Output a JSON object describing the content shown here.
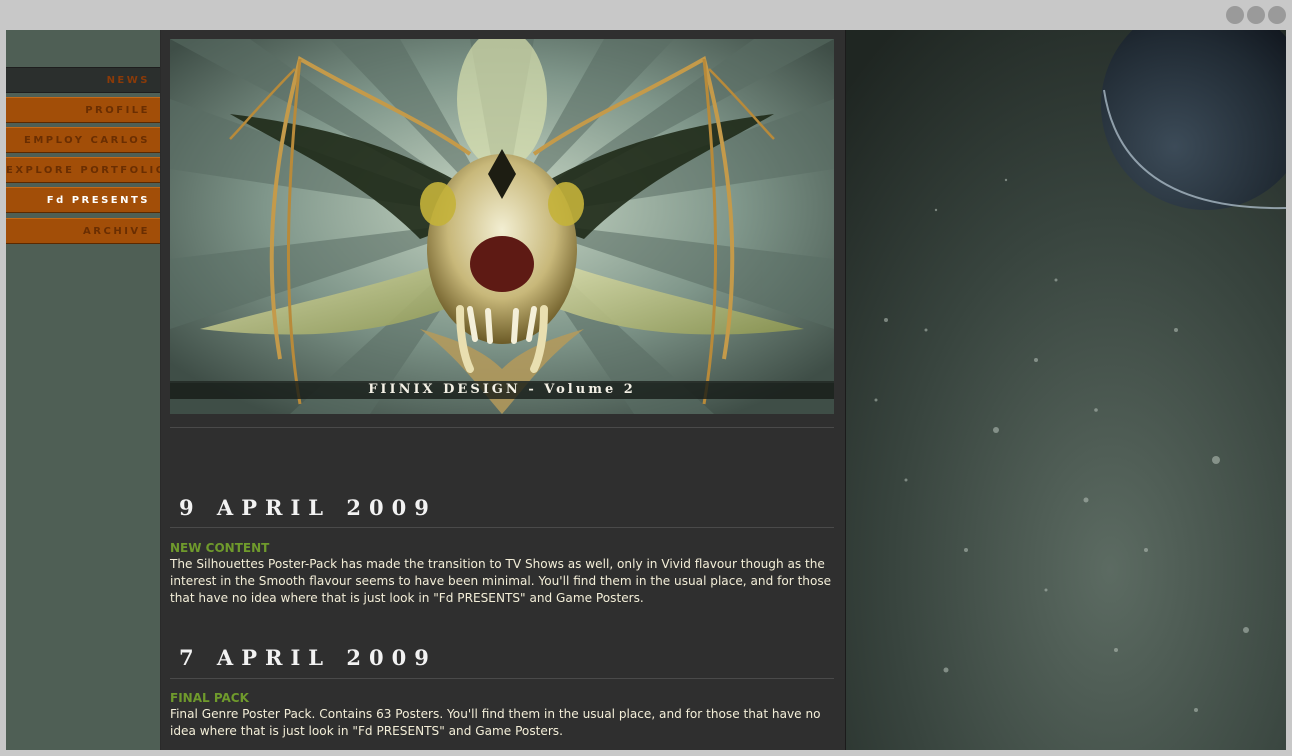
{
  "nav": {
    "items": [
      {
        "label": "NEWS",
        "state": "active"
      },
      {
        "label": "PROFILE",
        "state": "normal"
      },
      {
        "label": "EMPLOY CARLOS",
        "state": "normal"
      },
      {
        "label": "EXPLORE PORTFOLIO",
        "state": "normal"
      },
      {
        "label": "Fd PRESENTS",
        "state": "current"
      },
      {
        "label": "ARCHIVE",
        "state": "normal"
      }
    ]
  },
  "banner": {
    "caption": "FIINIX DESIGN - Volume 2"
  },
  "posts": [
    {
      "date": "9 APRIL 2009",
      "title": "NEW CONTENT",
      "body": "The Silhouettes Poster-Pack has made the transition to TV Shows as well, only in Vivid flavour though as the interest in the Smooth flavour seems to have been minimal. You'll find them in the usual place, and for those that have no idea where that is just look in \"Fd PRESENTS\" and Game Posters."
    },
    {
      "date": "7 APRIL 2009",
      "title": "FINAL PACK",
      "body": "Final Genre Poster Pack. Contains 63 Posters. You'll find them in the usual place, and for those that have no idea where that is just look in \"Fd PRESENTS\" and Game Posters."
    }
  ],
  "colors": {
    "nav_orange": "#a24e08",
    "post_title_green": "#6f9a2c",
    "content_bg": "#2f2f2f"
  }
}
